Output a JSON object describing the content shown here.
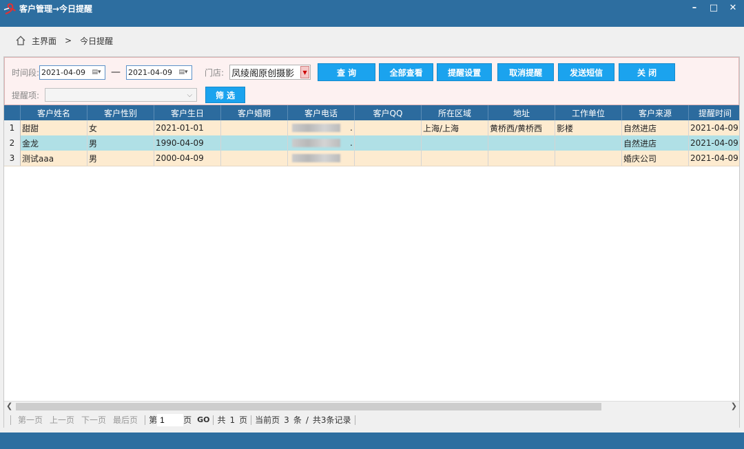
{
  "window": {
    "title": "客户管理→今日提醒",
    "minimize": "–",
    "maximize": "□",
    "close": "✕"
  },
  "breadcrumb": {
    "home": "主界面",
    "sep": ">",
    "current": "今日提醒"
  },
  "filters": {
    "period_label": "时间段:",
    "date_from": "2021-04-09",
    "date_sep": "—",
    "date_to": "2021-04-09",
    "store_label": "门店:",
    "store_value": "凤绫阁原创摄影",
    "remind_label": "提醒项:",
    "remind_value": ""
  },
  "buttons": {
    "query": "查 询",
    "view_all": "全部查看",
    "remind_settings": "提醒设置",
    "cancel_remind": "取消提醒",
    "send_sms": "发送短信",
    "close": "关 闭",
    "filter": "筛 选"
  },
  "grid": {
    "columns": [
      "客户姓名",
      "客户性别",
      "客户生日",
      "客户婚期",
      "客户电话",
      "客户QQ",
      "所在区域",
      "地址",
      "工作单位",
      "客户来源",
      "提醒时间"
    ],
    "rows": [
      {
        "num": "1",
        "name": "甜甜",
        "gender": "女",
        "birthday": "2021-01-01",
        "wedding": "",
        "phone": ".",
        "qq": "",
        "region": "上海/上海",
        "address": "黄桥西/黄桥西",
        "work": "影楼",
        "source": "自然进店",
        "remind": "2021-04-09"
      },
      {
        "num": "2",
        "name": "金龙",
        "gender": "男",
        "birthday": "1990-04-09",
        "wedding": "",
        "phone": ".",
        "qq": "",
        "region": "",
        "address": "",
        "work": "",
        "source": "自然进店",
        "remind": "2021-04-09"
      },
      {
        "num": "3",
        "name": "测试aaa",
        "gender": "男",
        "birthday": "2000-04-09",
        "wedding": "",
        "phone": "",
        "qq": "",
        "region": "",
        "address": "",
        "work": "",
        "source": "婚庆公司",
        "remind": "2021-04-09"
      }
    ]
  },
  "pager": {
    "first": "第一页",
    "prev": "上一页",
    "next": "下一页",
    "last": "最后页",
    "page_prefix": "第",
    "page_value": "1",
    "page_suffix": "页",
    "go": "GO",
    "total_prefix": "共",
    "total_pages": "1",
    "total_suffix": "页",
    "current_prefix": "当前页",
    "current_count": "3",
    "current_suffix": "条",
    "slash": "/",
    "total_records": "共3条记录"
  },
  "colors": {
    "titlebar": "#2d6ea0",
    "header": "#2c6b9e",
    "button": "#1ba3ee",
    "row_odd": "#fdebd0",
    "row_even": "#b0e0e6"
  },
  "icons": {
    "home": "home-icon",
    "calendar": "calendar-icon",
    "dropdown": "chevron-down-icon"
  }
}
